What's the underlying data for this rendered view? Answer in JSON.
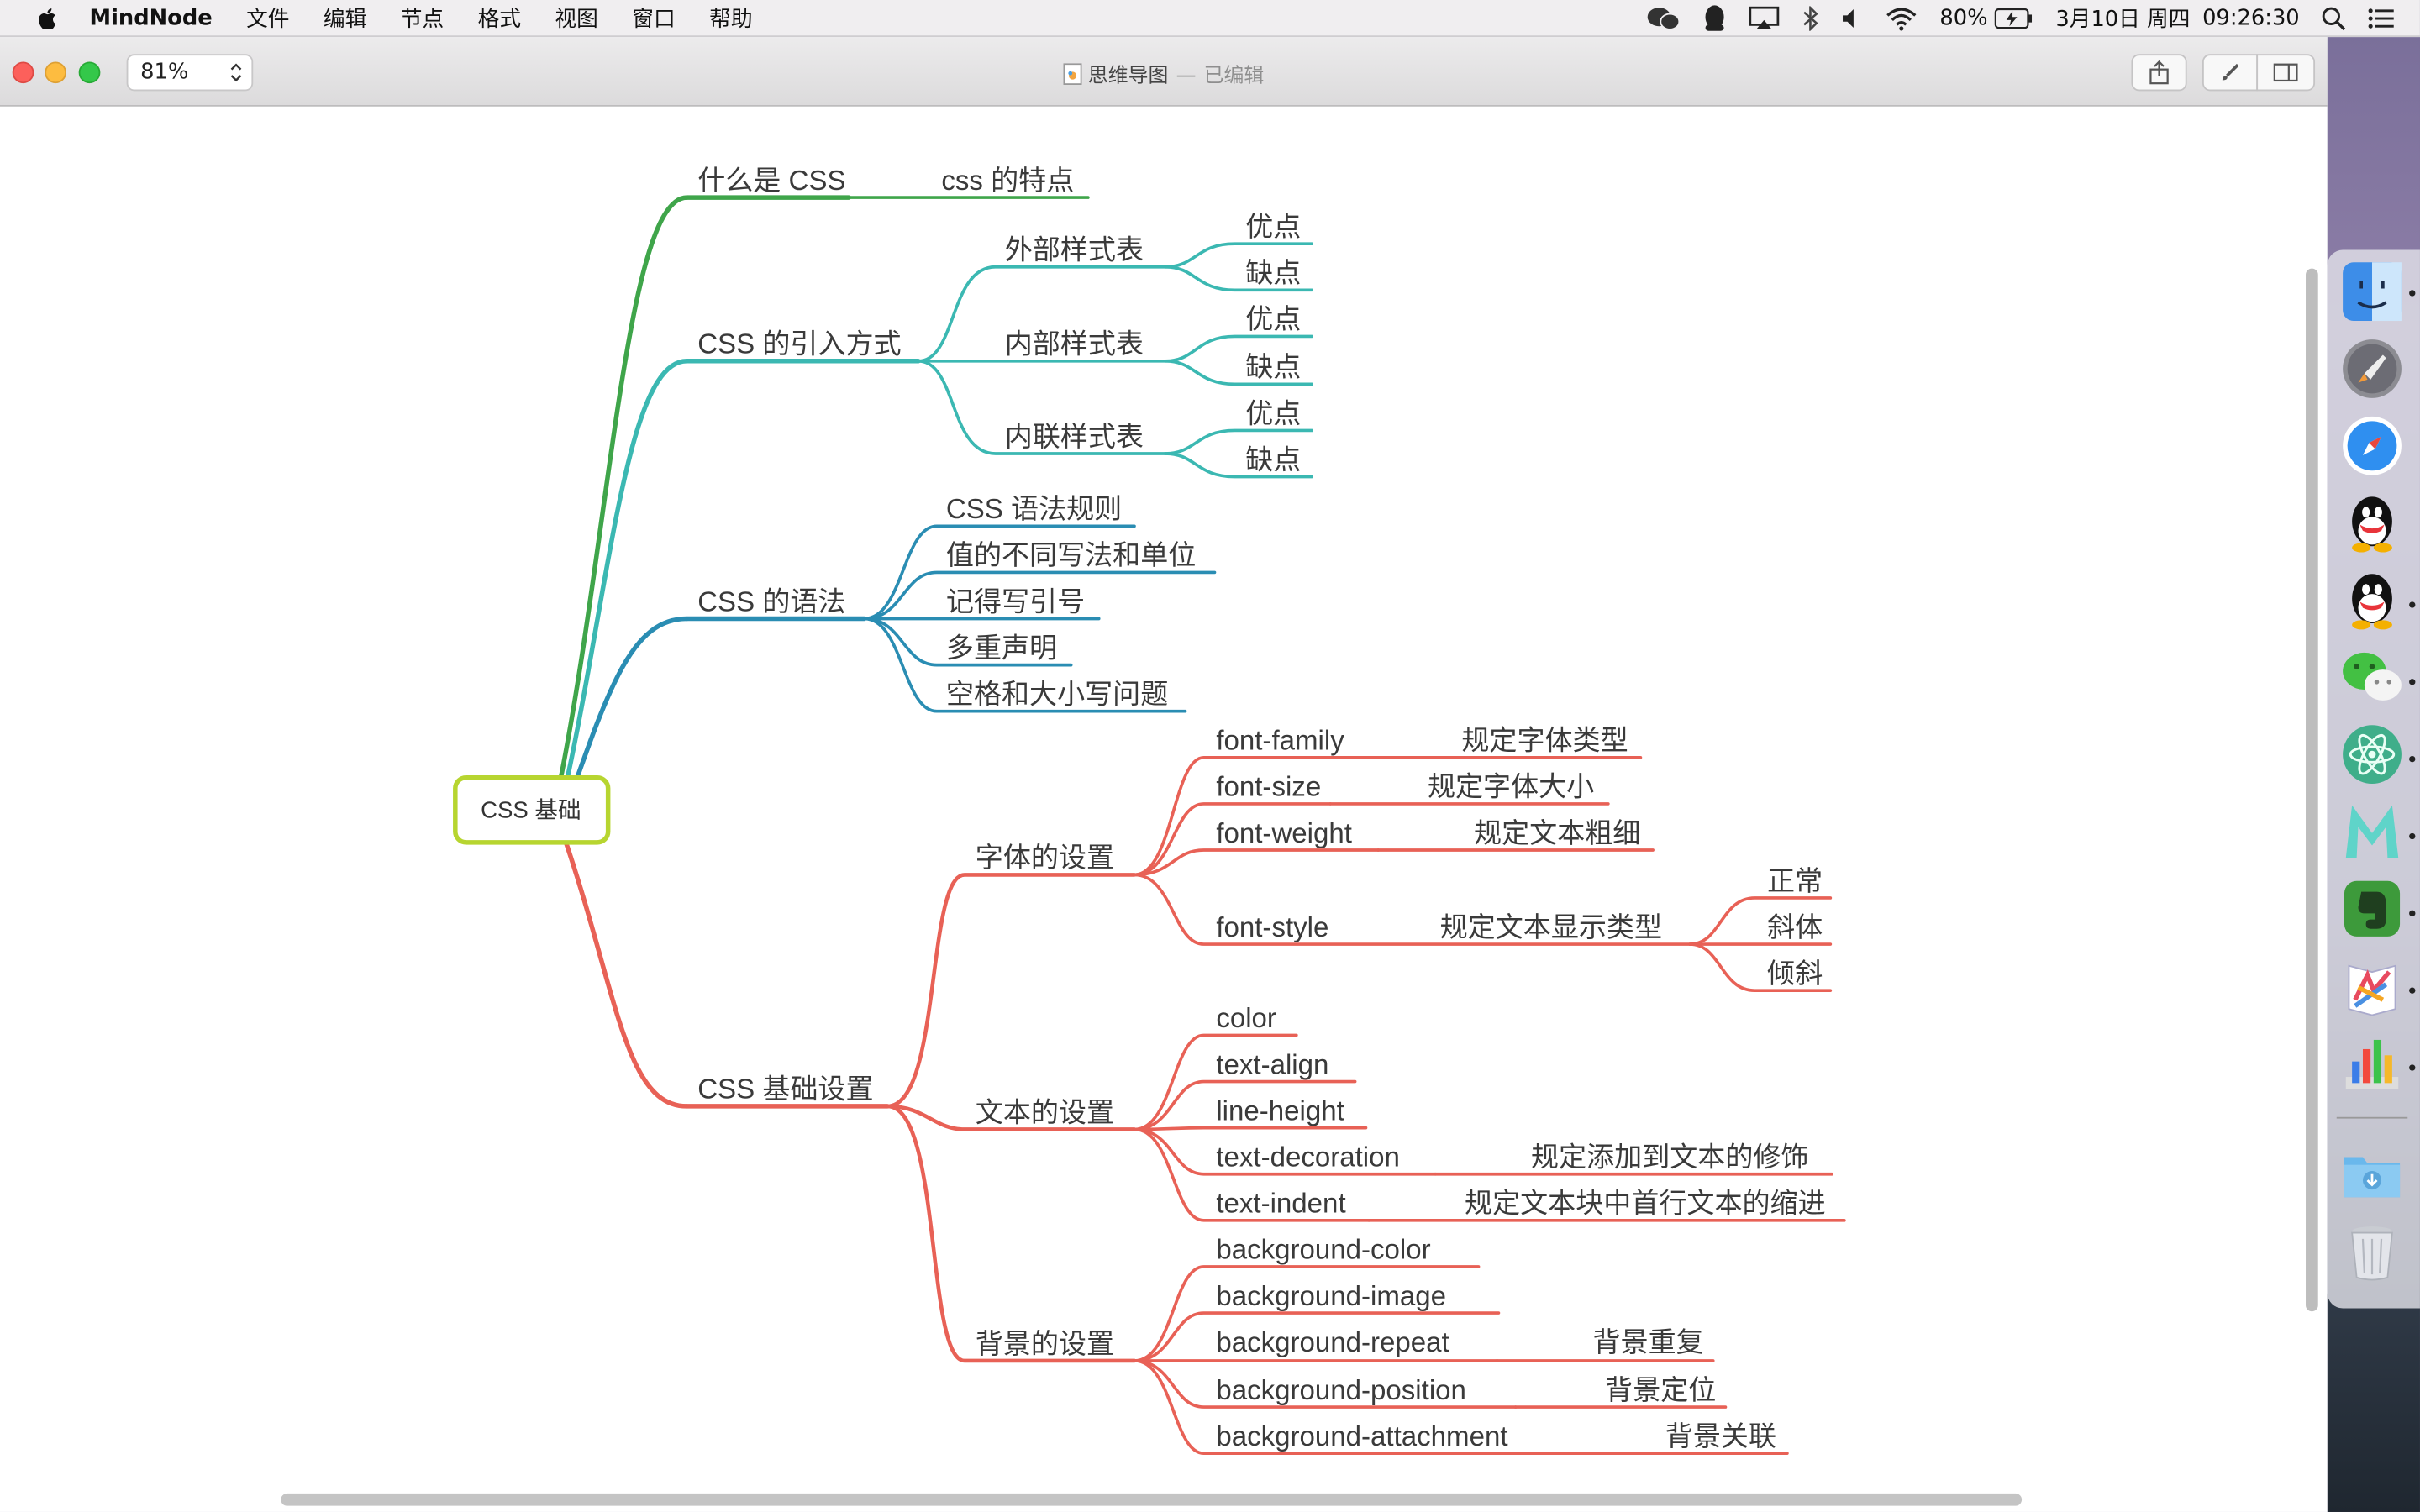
{
  "menubar": {
    "app_name": "MindNode",
    "menus": [
      "文件",
      "编辑",
      "节点",
      "格式",
      "视图",
      "窗口",
      "帮助"
    ],
    "status": {
      "battery": "80%",
      "date": "3月10日 周四",
      "time": "09:26:30"
    }
  },
  "window": {
    "zoom": "81%",
    "doc_title": "思维导图",
    "doc_separator": "—",
    "doc_state": "已编辑"
  },
  "colors": {
    "green": "#3fa54a",
    "teal": "#3bb8b2",
    "blue": "#2a8db3",
    "red": "#e86156",
    "root_border": "#b7d530"
  },
  "mindmap": {
    "root": "CSS 基础",
    "what": {
      "label": "什么是 CSS",
      "child": "css 的特点"
    },
    "intro": {
      "label": "CSS 的引入方式",
      "external": "外部样式表",
      "internal": "内部样式表",
      "inline": "内联样式表",
      "pro": "优点",
      "con": "缺点"
    },
    "syntax": {
      "label": "CSS 的语法",
      "items": [
        "CSS 语法规则",
        "值的不同写法和单位",
        "记得写引号",
        "多重声明",
        "空格和大小写问题"
      ]
    },
    "basic": {
      "label": "CSS 基础设置",
      "font": {
        "label": "字体的设置",
        "family": "font-family",
        "family_desc": "规定字体类型",
        "size": "font-size",
        "size_desc": "规定字体大小",
        "weight": "font-weight",
        "weight_desc": "规定文本粗细",
        "style": "font-style",
        "style_desc": "规定文本显示类型",
        "style_values": [
          "正常",
          "斜体",
          "倾斜"
        ]
      },
      "text": {
        "label": "文本的设置",
        "color": "color",
        "align": "text-align",
        "line_height": "line-height",
        "decoration": "text-decoration",
        "decoration_desc": "规定添加到文本的修饰",
        "indent": "text-indent",
        "indent_desc": "规定文本块中首行文本的缩进"
      },
      "background": {
        "label": "背景的设置",
        "color": "background-color",
        "image": "background-image",
        "repeat": "background-repeat",
        "repeat_desc": "背景重复",
        "position": "background-position",
        "position_desc": "背景定位",
        "attachment": "background-attachment",
        "attachment_desc": "背景关联"
      }
    }
  }
}
